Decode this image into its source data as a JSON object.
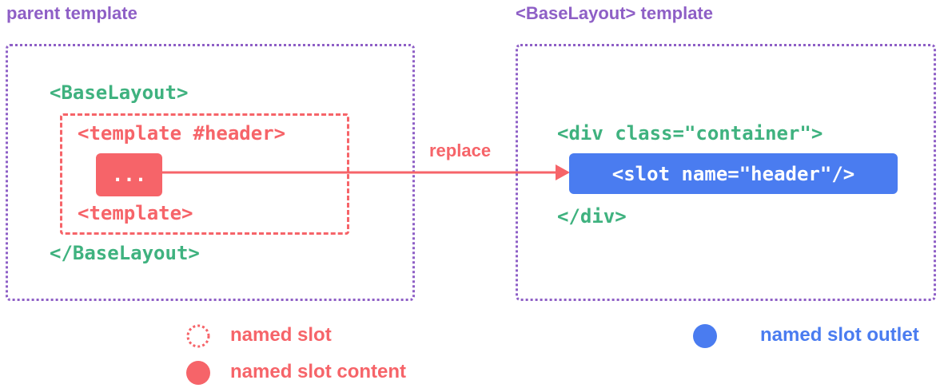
{
  "left": {
    "title": "parent template",
    "base_open": "<BaseLayout>",
    "template_open": "<template #header>",
    "content": "...",
    "template_close": "<template>",
    "base_close": "</BaseLayout>"
  },
  "right": {
    "title": "<BaseLayout> template",
    "div_open": "<div class=\"container\">",
    "slot": "<slot name=\"header\"/>",
    "div_close": "</div>"
  },
  "arrow": {
    "label": "replace"
  },
  "legend": {
    "named_slot": "named slot",
    "named_slot_content": "named slot content",
    "named_slot_outlet": "named slot outlet"
  },
  "colors": {
    "purple": "#8e5fc6",
    "green": "#3fb27f",
    "red": "#f66469",
    "blue": "#4a7cf0"
  }
}
